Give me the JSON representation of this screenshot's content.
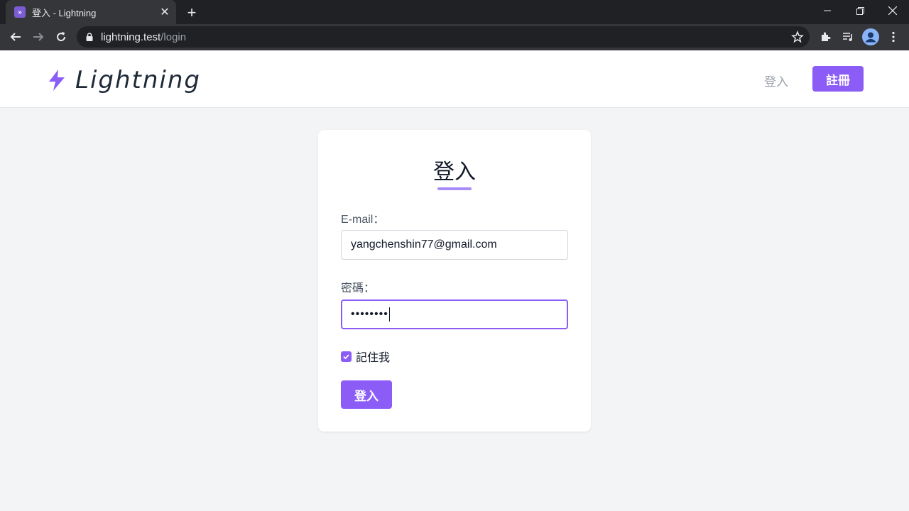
{
  "browser": {
    "tab_title": "登入 - Lightning",
    "tab_favicon": "»",
    "url_host": "lightning.test",
    "url_path": "/login"
  },
  "header": {
    "brand": "Lightning",
    "nav_login": "登入",
    "nav_register": "註冊"
  },
  "form": {
    "title": "登入",
    "email_label": "E-mail：",
    "email_value": "yangchenshin77@gmail.com",
    "password_label": "密碼：",
    "password_value": "••••••••",
    "remember_label": "記住我",
    "remember_checked": true,
    "submit_label": "登入"
  },
  "colors": {
    "accent": "#8b5cf6",
    "accent_light": "#a78bfa",
    "background": "#f3f4f6"
  }
}
